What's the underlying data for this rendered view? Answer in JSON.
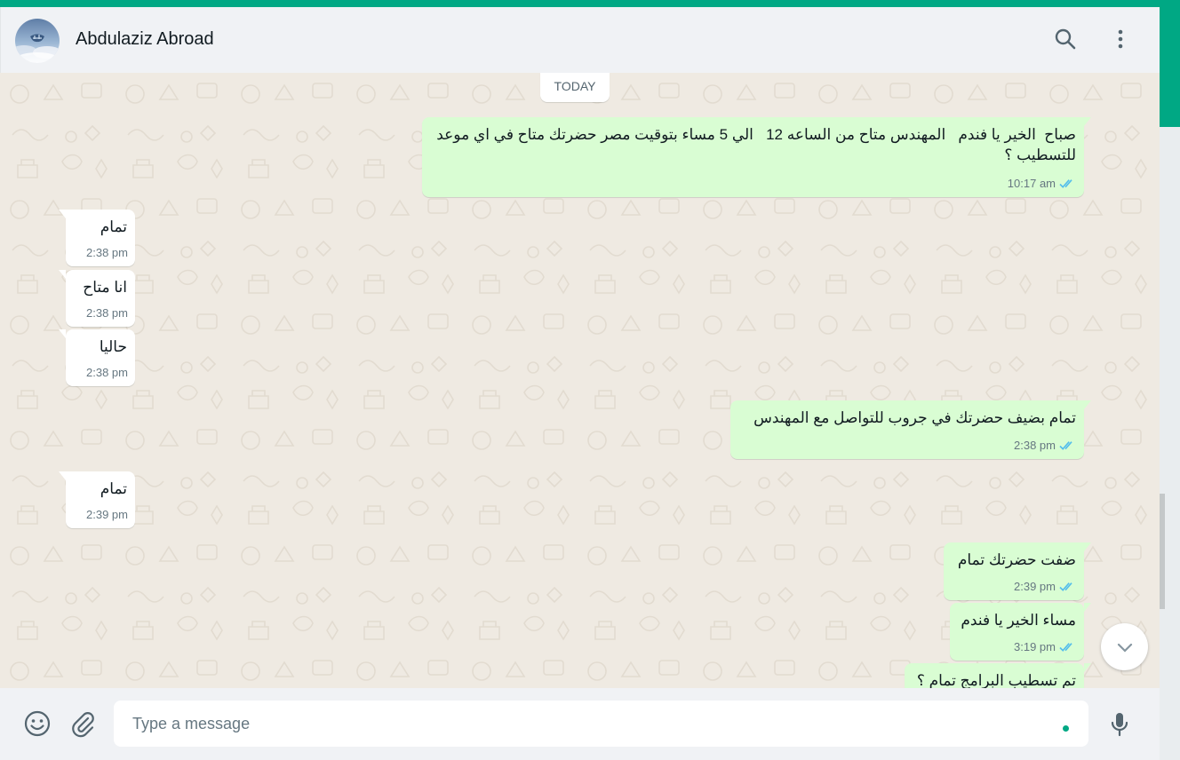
{
  "colors": {
    "accent": "#00a884",
    "outgoing_bubble": "#d9fdd3",
    "incoming_bubble": "#ffffff",
    "chat_bg": "#efeae2",
    "read_ticks": "#53bdeb"
  },
  "header": {
    "contact_name": "Abdulaziz Abroad",
    "icons": [
      "search-icon",
      "menu-dots-icon"
    ]
  },
  "chat": {
    "date_divider": "TODAY",
    "messages": [
      {
        "direction": "out",
        "text": "صباح  الخير يا فندم   المهندس متاح من الساعه 12   الي 5 مساء بتوقيت مصر حضرتك متاح في اي موعد للتسطيب ؟",
        "time": "10:17 am",
        "status": "read"
      },
      {
        "direction": "in",
        "text": "تمام",
        "time": "2:38 pm"
      },
      {
        "direction": "in",
        "text": "انا متاح",
        "time": "2:38 pm"
      },
      {
        "direction": "in",
        "text": "حاليا",
        "time": "2:38 pm"
      },
      {
        "direction": "out",
        "text": "تمام بضيف حضرتك في جروب للتواصل مع المهندس",
        "time": "2:38 pm",
        "status": "read"
      },
      {
        "direction": "in",
        "text": "تمام",
        "time": "2:39 pm"
      },
      {
        "direction": "out",
        "text": "ضفت حضرتك تمام",
        "time": "2:39 pm",
        "status": "read"
      },
      {
        "direction": "out",
        "text": "مساء الخير يا فندم",
        "time": "3:19 pm",
        "status": "read"
      },
      {
        "direction": "out",
        "text": "تم تسطيب البرامج تمام ؟",
        "time": "",
        "status": "read"
      }
    ]
  },
  "footer": {
    "placeholder": "Type a message",
    "icons": [
      "emoji-icon",
      "attach-icon",
      "microphone-icon"
    ]
  }
}
